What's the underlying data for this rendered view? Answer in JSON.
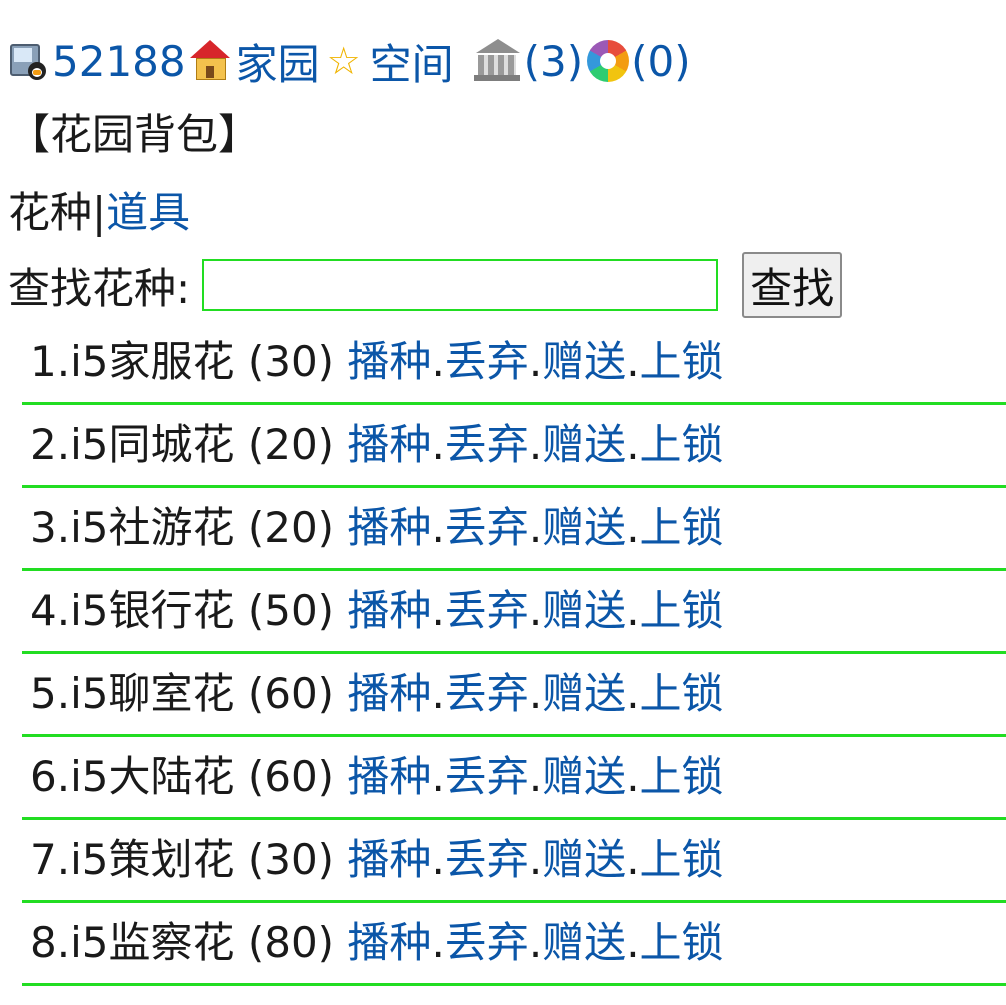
{
  "topbar": {
    "user_id": "52188",
    "home_label": "家园",
    "space_label": "空间",
    "bank_count": "(3)",
    "wheel_count": "(0)"
  },
  "page_title": "【花园背包】",
  "tabs": {
    "active": "花种",
    "separator": "|",
    "other": "道具"
  },
  "search": {
    "label": "查找花种:",
    "value": "",
    "button": "查找"
  },
  "actions": {
    "sow": "播种",
    "discard": "丢弃",
    "gift": "赠送",
    "lock": "上锁",
    "dot": "."
  },
  "items": [
    {
      "index": "1.",
      "name": "i5家服花",
      "count": "(30)"
    },
    {
      "index": "2.",
      "name": "i5同城花",
      "count": "(20)"
    },
    {
      "index": "3.",
      "name": "i5社游花",
      "count": "(20)"
    },
    {
      "index": "4.",
      "name": "i5银行花",
      "count": "(50)"
    },
    {
      "index": "5.",
      "name": "i5聊室花",
      "count": "(60)"
    },
    {
      "index": "6.",
      "name": "i5大陆花",
      "count": "(60)"
    },
    {
      "index": "7.",
      "name": "i5策划花",
      "count": "(30)"
    },
    {
      "index": "8.",
      "name": "i5监察花",
      "count": "(80)"
    }
  ],
  "colors": {
    "link": "#0b56a8",
    "row_border": "#22dd22",
    "text": "#1a1a1a"
  },
  "icons": [
    "user-qq-icon",
    "house-icon",
    "star-icon",
    "bank-icon",
    "color-wheel-icon"
  ]
}
